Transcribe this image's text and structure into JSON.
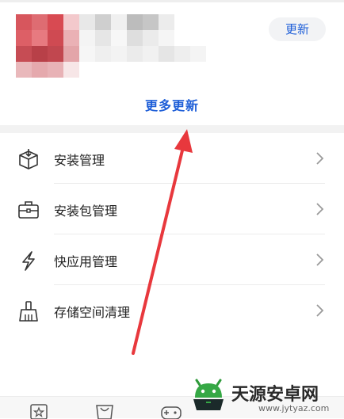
{
  "update_card": {
    "update_button": "更新",
    "more_updates_link": "更多更新"
  },
  "menu": {
    "items": [
      {
        "label": "安装管理",
        "icon": "package-box-icon"
      },
      {
        "label": "安装包管理",
        "icon": "briefcase-icon"
      },
      {
        "label": "快应用管理",
        "icon": "lightning-icon"
      },
      {
        "label": "存储空间清理",
        "icon": "broom-icon"
      }
    ]
  },
  "annotation": {
    "color": "#e8383d"
  },
  "bottom_nav": {
    "icons": [
      "star-icon",
      "bag-icon",
      "gamepad-icon"
    ]
  },
  "watermark": {
    "title": "天源安卓网",
    "url": "www.jytyaz.com"
  },
  "colors": {
    "accent": "#1f5fd8",
    "separator": "#f2f2f2"
  }
}
